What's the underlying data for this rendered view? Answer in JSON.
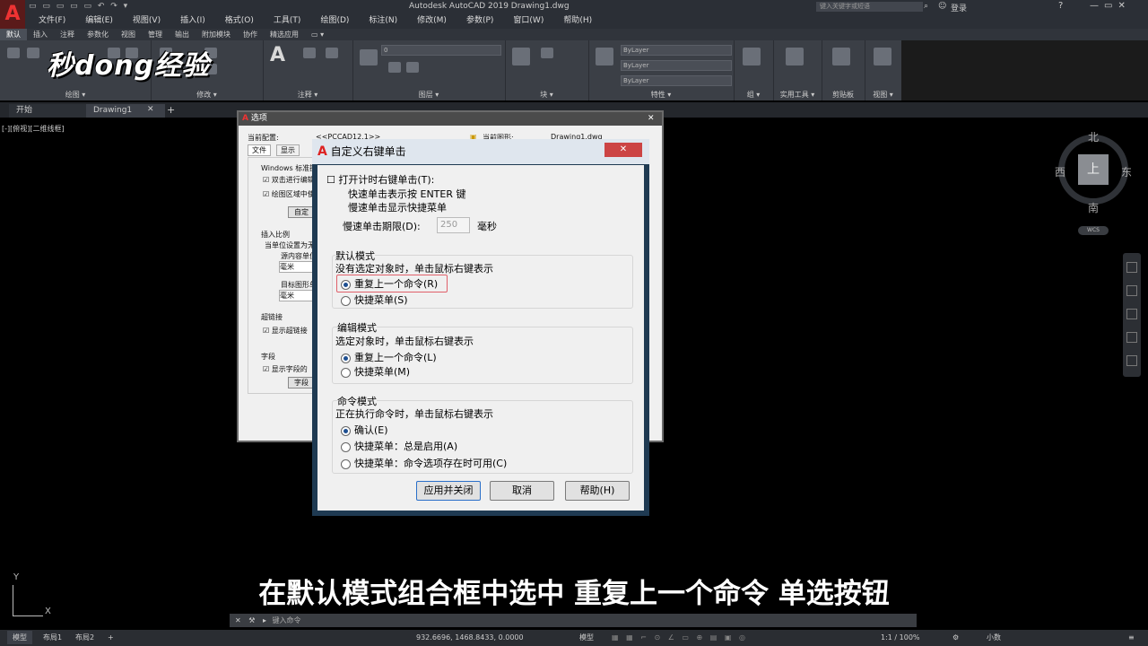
{
  "app": {
    "title": "Autodesk AutoCAD 2019    Drawing1.dwg",
    "search_placeholder": "键入关键字或短语",
    "login": "登录",
    "menus": [
      "文件(F)",
      "编辑(E)",
      "视图(V)",
      "插入(I)",
      "格式(O)",
      "工具(T)",
      "绘图(D)",
      "标注(N)",
      "修改(M)",
      "参数(P)",
      "窗口(W)",
      "帮助(H)"
    ]
  },
  "ribbon": {
    "tabs": [
      "默认",
      "插入",
      "注释",
      "参数化",
      "视图",
      "管理",
      "输出",
      "附加模块",
      "协作",
      "精选应用"
    ],
    "groups": [
      "绘图 ▾",
      "修改 ▾",
      "注释 ▾",
      "图层 ▾",
      "块 ▾",
      "特性 ▾",
      "组 ▾",
      "实用工具 ▾",
      "剪贴板",
      "视图 ▾"
    ],
    "bylayer": [
      "ByLayer",
      "ByLayer",
      "ByLayer"
    ],
    "layer_value": "0"
  },
  "watermark": "秒dong经验",
  "doc_tabs": [
    "开始",
    "Drawing1"
  ],
  "viewport_label": "[-][俯视][二维线框]",
  "viewcube": {
    "north": "北",
    "south": "南",
    "east": "东",
    "west": "西",
    "face": "上",
    "wcs": "WCS"
  },
  "options_dialog": {
    "title": "选项",
    "current_profile_label": "当前配置:",
    "current_profile_value": "<<PCCAD12.1>>",
    "current_drawing_label": "当前图形:",
    "current_drawing_value": "Drawing1.dwg",
    "tabs": [
      "文件",
      "显示"
    ],
    "windows_std": "Windows 标准操",
    "chk1": "双击进行编辑",
    "chk2": "绘图区域中使",
    "custom_btn": "自定",
    "insert_scale": "插入比例",
    "unit_set": "当单位设置为无",
    "src_unit": "源内容单位",
    "src_unit_val": "毫米",
    "tgt_unit": "目标图形单",
    "tgt_unit_val": "毫米",
    "hyperlink": "超链接",
    "show_hyperlink": "显示超链接",
    "field": "字段",
    "show_field": "显示字段的",
    "field_btn": "字段"
  },
  "rc_dialog": {
    "title": "自定义右键单击",
    "timed_right_click": "打开计时右键单击(T):",
    "fast_click": "快速单击表示按 ENTER 键",
    "slow_click": "慢速单击显示快捷菜单",
    "duration_label": "慢速单击期限(D):",
    "duration_value": "250",
    "duration_unit": "毫秒",
    "default_mode": {
      "title": "默认模式",
      "desc": "没有选定对象时，单击鼠标右键表示",
      "opt_repeat": "重复上一个命令(R)",
      "opt_menu": "快捷菜单(S)"
    },
    "edit_mode": {
      "title": "编辑模式",
      "desc": "选定对象时，单击鼠标右键表示",
      "opt_repeat": "重复上一个命令(L)",
      "opt_menu": "快捷菜单(M)"
    },
    "command_mode": {
      "title": "命令模式",
      "desc": "正在执行命令时，单击鼠标右键表示",
      "opt_enter": "确认(E)",
      "opt_always": "快捷菜单：总是启用(A)",
      "opt_options": "快捷菜单：命令选项存在时可用(C)"
    },
    "btn_apply": "应用并关闭",
    "btn_cancel": "取消",
    "btn_help": "帮助(H)"
  },
  "subtitle": "在默认模式组合框中选中 重复上一个命令 单选按钮",
  "ucs": {
    "x": "X",
    "y": "Y"
  },
  "command_placeholder": "键入命令",
  "status": {
    "layout_tabs": [
      "模型",
      "布局1",
      "布局2"
    ],
    "coords": "932.6696, 1468.8433, 0.0000",
    "model_space": "模型",
    "scale": "1:1 / 100%",
    "units": "小数"
  },
  "colors": {
    "accent": "#e33b3b",
    "dialog_bg": "#f0f0f0",
    "highlight_box": "#e0606a"
  }
}
